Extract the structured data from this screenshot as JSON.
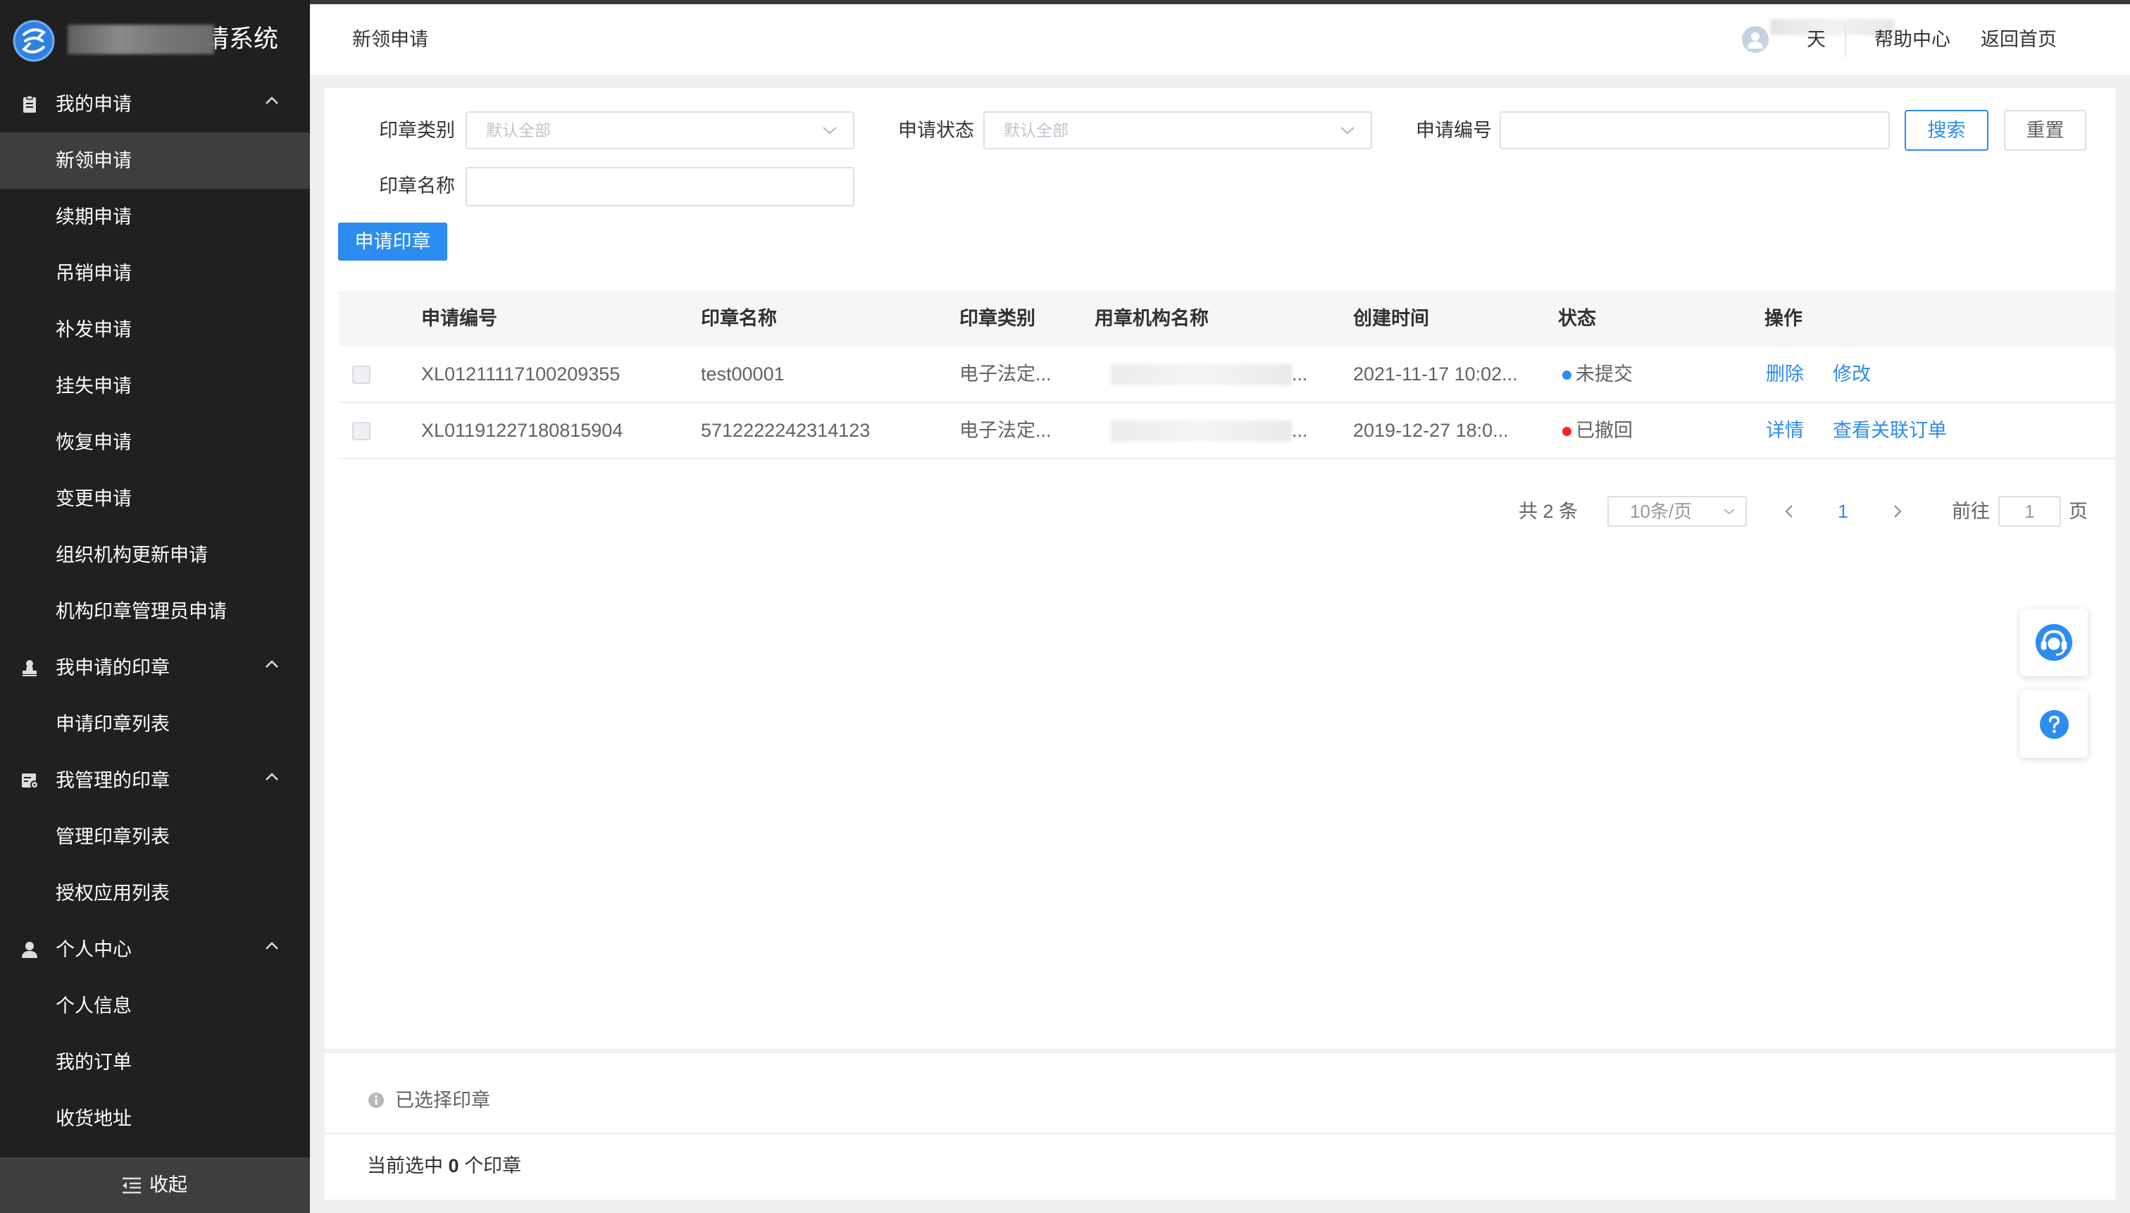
{
  "app": {
    "title": "请系统",
    "logo_icon": "logo-icon"
  },
  "sidebar": {
    "groups": [
      {
        "label": "我的申请",
        "icon": "clipboard-icon",
        "expanded": true,
        "items": [
          {
            "label": "新领申请",
            "selected": true
          },
          {
            "label": "续期申请"
          },
          {
            "label": "吊销申请"
          },
          {
            "label": "补发申请"
          },
          {
            "label": "挂失申请"
          },
          {
            "label": "恢复申请"
          },
          {
            "label": "变更申请"
          },
          {
            "label": "组织机构更新申请"
          },
          {
            "label": "机构印章管理员申请"
          }
        ]
      },
      {
        "label": "我申请的印章",
        "icon": "stamp-icon",
        "expanded": true,
        "items": [
          {
            "label": "申请印章列表"
          }
        ]
      },
      {
        "label": "我管理的印章",
        "icon": "seal-manage-icon",
        "expanded": true,
        "items": [
          {
            "label": "管理印章列表"
          },
          {
            "label": "授权应用列表"
          }
        ]
      },
      {
        "label": "个人中心",
        "icon": "user-icon",
        "expanded": true,
        "items": [
          {
            "label": "个人信息"
          },
          {
            "label": "我的订单"
          },
          {
            "label": "收货地址"
          }
        ]
      }
    ],
    "collapse_label": "收起",
    "collapse_icon": "indent-icon"
  },
  "header": {
    "page_title": "新领申请",
    "user_name": "天",
    "help_label": "帮助中心",
    "home_label": "返回首页"
  },
  "filters": {
    "seal_type": {
      "label": "印章类别",
      "placeholder": "默认全部"
    },
    "apply_status": {
      "label": "申请状态",
      "placeholder": "默认全部"
    },
    "apply_no": {
      "label": "申请编号",
      "value": ""
    },
    "seal_name": {
      "label": "印章名称",
      "value": ""
    },
    "search_label": "搜索",
    "reset_label": "重置"
  },
  "apply_button": "申请印章",
  "table": {
    "columns": [
      "申请编号",
      "印章名称",
      "印章类别",
      "用章机构名称",
      "创建时间",
      "状态",
      "操作"
    ],
    "rows": [
      {
        "apply_no": "XL01211117100209355",
        "seal_name": "test00001",
        "seal_type": "电子法定...",
        "org_name": "...",
        "created": "2021-11-17 10:02...",
        "status": "未提交",
        "status_color": "#2d8cf0",
        "actions": [
          "删除",
          "修改"
        ]
      },
      {
        "apply_no": "XL01191227180815904",
        "seal_name": "5712222242314123",
        "seal_type": "电子法定...",
        "org_name": "...",
        "created": "2019-12-27 18:0...",
        "status": "已撤回",
        "status_color": "#f5222d",
        "actions": [
          "详情",
          "查看关联订单"
        ]
      }
    ]
  },
  "pagination": {
    "total_text": "共 2 条",
    "page_size": "10条/页",
    "current_page": "1",
    "goto_label": "前往",
    "goto_value": "1",
    "page_unit": "页"
  },
  "float_buttons": {
    "support_icon": "headset-icon",
    "help_icon": "question-icon"
  },
  "selection": {
    "title": "已选择印章",
    "prefix": "当前选中",
    "count": "0",
    "suffix": "个印章"
  },
  "colors": {
    "primary": "#2d8cf0",
    "sidebar_bg": "#202020",
    "sidebar_selected_bg": "#3e3e3e",
    "danger": "#f5222d"
  }
}
